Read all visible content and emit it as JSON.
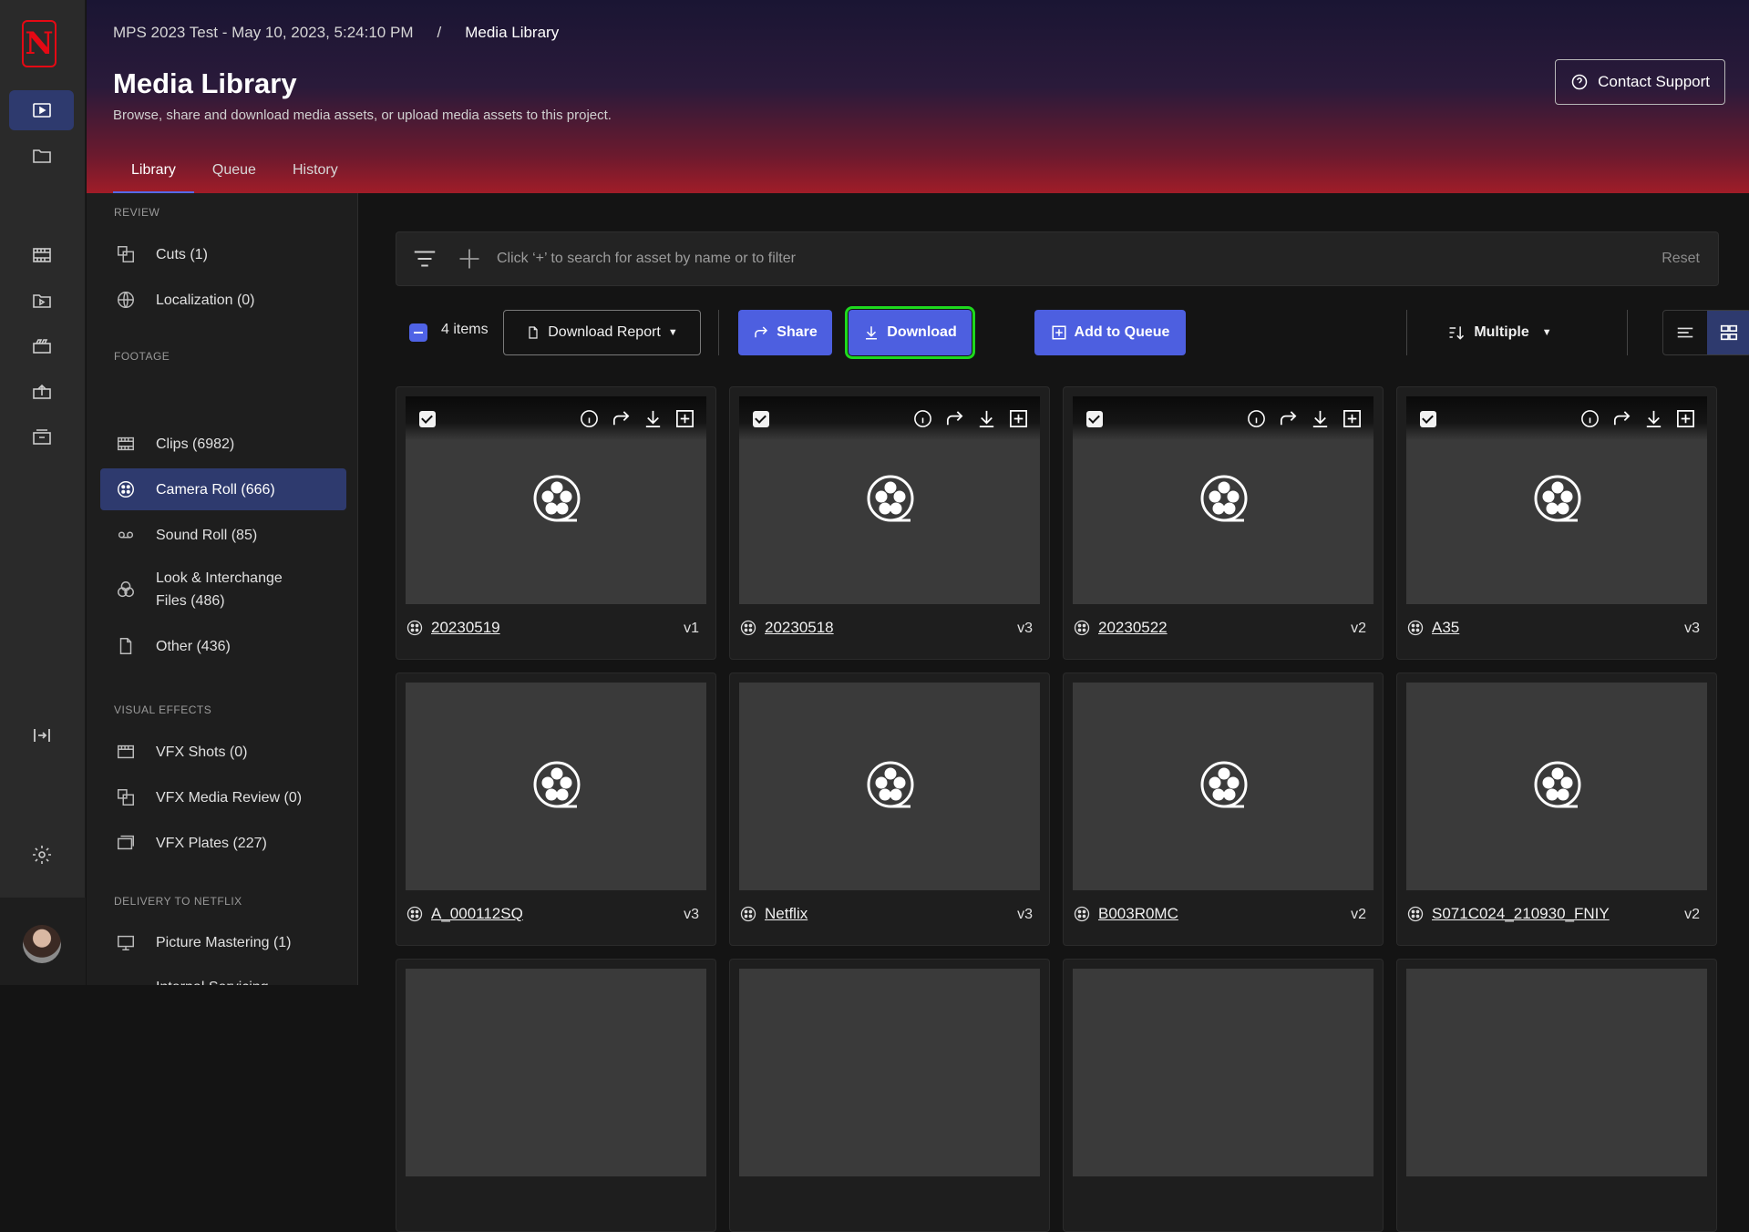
{
  "rail": {
    "logo": "N",
    "icons": [
      "media-library-icon",
      "folder-icon",
      "clips-icon",
      "camera-roll-icon",
      "vfx-icon",
      "upload-icon",
      "delivery-icon",
      "collapse-rail-icon",
      "settings-icon"
    ]
  },
  "header": {
    "breadcrumb_project": "MPS 2023 Test - May 10, 2023, 5:24:10 PM",
    "breadcrumb_sep": "/",
    "breadcrumb_current": "Media Library",
    "title": "Media Library",
    "subtitle": "Browse, share and download media assets, or upload media assets to this project.",
    "support_label": "Contact Support",
    "tabs": [
      "Library",
      "Queue",
      "History"
    ],
    "active_tab": "Library"
  },
  "sidebar": {
    "sections": {
      "review": "REVIEW",
      "footage": "FOOTAGE",
      "vfx": "VISUAL EFFECTS",
      "delivery": "DELIVERY TO NETFLIX"
    },
    "items": [
      {
        "label": "Cuts (1)",
        "icon": "cuts-icon"
      },
      {
        "label": "Localization (0)",
        "icon": "globe-icon"
      },
      {
        "label": "Clips (6982)",
        "icon": "clips-icon"
      },
      {
        "label": "Camera Roll (666)",
        "icon": "reel-icon",
        "active": true
      },
      {
        "label": "Sound Roll (85)",
        "icon": "tape-icon"
      },
      {
        "label": "Look & Interchange Files (486)",
        "icon": "color-circles-icon"
      },
      {
        "label": "Other (436)",
        "icon": "file-icon"
      },
      {
        "label": "VFX Shots (0)",
        "icon": "vfx-shots-icon"
      },
      {
        "label": "VFX Media Review (0)",
        "icon": "vfx-review-icon"
      },
      {
        "label": "VFX Plates (227)",
        "icon": "vfx-plates-icon"
      },
      {
        "label": "Picture Mastering (1)",
        "icon": "monitor-icon"
      },
      {
        "label": "Internal Servicing",
        "icon": "none"
      }
    ]
  },
  "search": {
    "placeholder": "Click ‘+’ to search for asset by name or to filter",
    "reset": "Reset"
  },
  "toolbar": {
    "count": "4 items",
    "report": "Download Report",
    "share": "Share",
    "download": "Download",
    "queue": "Add to Queue",
    "sort": "Multiple"
  },
  "cards": [
    {
      "name": "20230519",
      "version": "v1",
      "selected": true
    },
    {
      "name": "20230518",
      "version": "v3",
      "selected": true
    },
    {
      "name": "20230522",
      "version": "v2",
      "selected": true
    },
    {
      "name": "A35",
      "version": "v3",
      "selected": true
    },
    {
      "name": "A_000112SQ",
      "version": "v3",
      "selected": false
    },
    {
      "name": "Netflix",
      "version": "v3",
      "selected": false
    },
    {
      "name": "B003R0MC",
      "version": "v2",
      "selected": false
    },
    {
      "name": "S071C024_210930_FNIY",
      "version": "v2",
      "selected": false
    }
  ],
  "colors": {
    "accent": "#4d5fe0",
    "active_nav": "#2e3a6e",
    "highlight": "#1ed91e",
    "brand": "#e50914"
  }
}
